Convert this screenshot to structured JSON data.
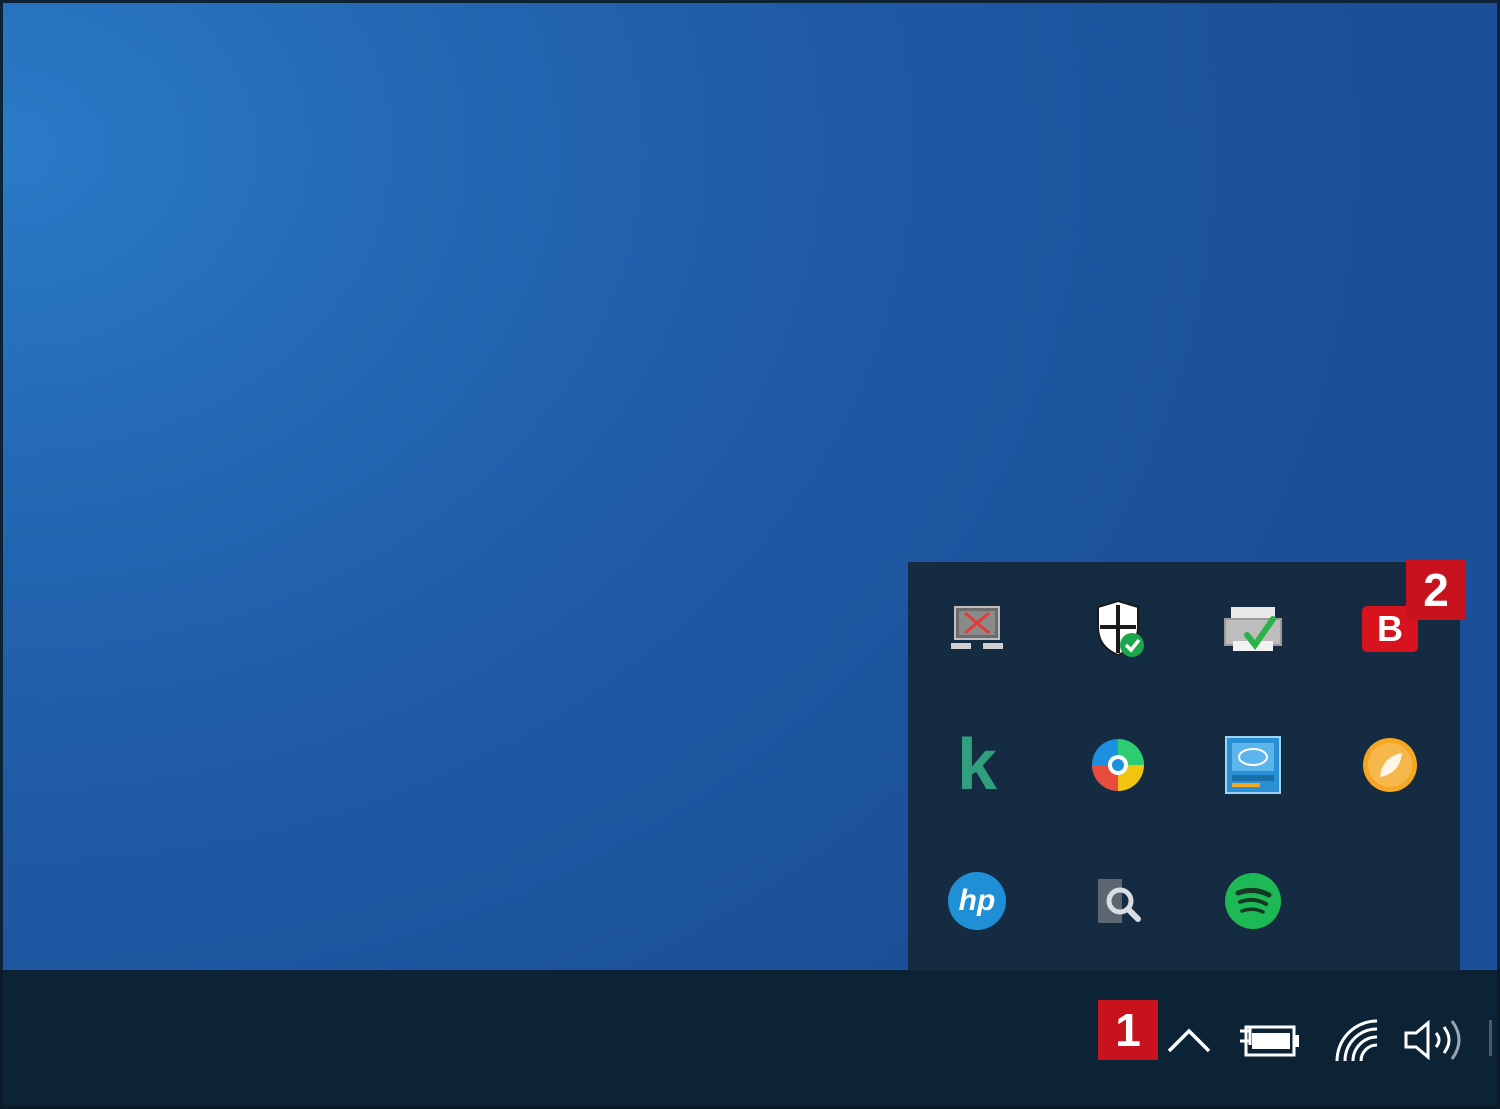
{
  "screen": {
    "desktop_color": "#1f5aa5",
    "taskbar_color": "#0c2336",
    "flyout_color": "#152b42"
  },
  "tray_flyout": {
    "icons": [
      {
        "name": "remote-desktop-disconnected-icon"
      },
      {
        "name": "windows-security-icon"
      },
      {
        "name": "printer-ok-icon"
      },
      {
        "name": "bitdefender-icon",
        "letter": "B"
      },
      {
        "name": "kaspersky-icon",
        "letter": "k"
      },
      {
        "name": "microsoft-edge-icon"
      },
      {
        "name": "intel-graphics-icon"
      },
      {
        "name": "orange-leaf-app-icon"
      },
      {
        "name": "hp-icon",
        "letter": "hp"
      },
      {
        "name": "search-indexer-icon"
      },
      {
        "name": "spotify-icon"
      }
    ]
  },
  "taskbar": {
    "icons": [
      {
        "name": "show-hidden-icons-chevron-icon"
      },
      {
        "name": "battery-charging-icon"
      },
      {
        "name": "wifi-icon"
      },
      {
        "name": "volume-icon"
      }
    ]
  },
  "annotations": {
    "badge_1": "1",
    "badge_2": "2",
    "color": "#c8131e"
  }
}
